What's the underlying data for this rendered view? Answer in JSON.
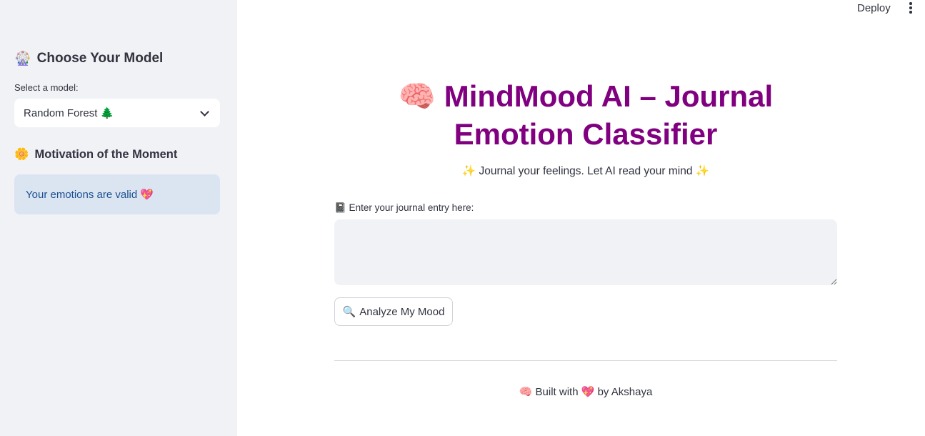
{
  "header": {
    "deploy_label": "Deploy",
    "menu_icon": "kebab-menu-icon"
  },
  "sidebar": {
    "model_heading_emoji": "🎡",
    "model_heading": "Choose Your Model",
    "select_label": "Select a model:",
    "selected_model": "Random Forest 🌲",
    "motivation_heading_emoji": "🌼",
    "motivation_heading": "Motivation of the Moment",
    "motivation_text": "Your emotions are valid 💖"
  },
  "main": {
    "title": "🧠 MindMood AI – Journal Emotion Classifier",
    "subtitle": "✨ Journal your feelings. Let AI read your mind ✨",
    "journal_label": "📓 Enter your journal entry here:",
    "journal_value": "",
    "analyze_button_emoji": "🔍",
    "analyze_button": "Analyze My Mood",
    "footer": "🧠 Built with 💖 by Akshaya"
  },
  "colors": {
    "title": "#800080",
    "sidebar_bg": "#f0f2f6",
    "info_bg": "#dbe5f1",
    "info_text": "#1d4f91"
  }
}
